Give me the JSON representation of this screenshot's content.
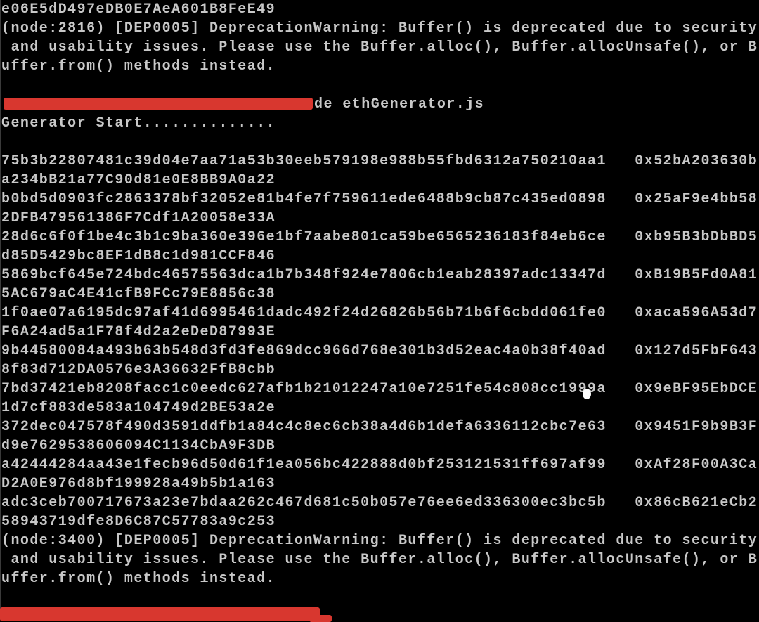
{
  "terminal": {
    "top_line": "e06E5dD497eDB0E7AeA601B8FeE49",
    "warning1": [
      "(node:2816) [DEP0005] DeprecationWarning: Buffer() is deprecated due to security",
      " and usability issues. Please use the Buffer.alloc(), Buffer.allocUnsafe(), or B",
      "uffer.from() methods instead."
    ],
    "command_visible": "de ethGenerator.js",
    "generator_start": "Generator Start..............",
    "rows": [
      {
        "key": "75b3b22807481c39d04e7aa71a53b30eeb579198e988b55fbd6312a750210aa1",
        "addr_head": "0x52bA203630b",
        "addr_tail": "a234bB21a77C90d81e0E8BB9A0a22"
      },
      {
        "key": "b0bd5d0903fc2863378bf32052e81b4fe7f759611ede6488b9cb87c435ed0898",
        "addr_head": "0x25aF9e4bb58",
        "addr_tail": "2DFB479561386F7Cdf1A20058e33A"
      },
      {
        "key": "28d6c6f0f1be4c3b1c9ba360e396e1bf7aabe801ca59be6565236183f84eb6ce",
        "addr_head": "0xb95B3bDbBD5",
        "addr_tail": "d85D5429bc8EF1dB8c1d981CCF846"
      },
      {
        "key": "5869bcf645e724bdc46575563dca1b7b348f924e7806cb1eab28397adc13347d",
        "addr_head": "0xB19B5Fd0A81",
        "addr_tail": "5AC679aC4E41cfB9FCc79E8856c38"
      },
      {
        "key": "1f0ae07a6195dc97af41d6995461dadc492f24d26826b56b71b6f6cbdd061fe0",
        "addr_head": "0xaca596A53d7",
        "addr_tail": "F6A24ad5a1F78f4d2a2eDeD87993E"
      },
      {
        "key": "9b44580084a493b63b548d3fd3fe869dcc966d768e301b3d52eac4a0b38f40ad",
        "addr_head": "0x127d5FbF643",
        "addr_tail": "8f83d712DA0576e3A36632FfB8cbb"
      },
      {
        "key": "7bd37421eb8208facc1c0eedc627afb1b21012247a10e7251fe54c808cc1999a",
        "addr_head": "0x9eBF95EbDCE",
        "addr_tail": "1d7cf883de583a104749d2BE53a2e"
      },
      {
        "key": "372dec047578f490d3591ddfb1a84c4c8ec6cb38a4d6b1defa6336112cbc7e63",
        "addr_head": "0x9451F9b9B3F",
        "addr_tail": "d9e7629538606094C1134CbA9F3DB"
      },
      {
        "key": "a42444284aa43e1fecb96d50d61f1ea056bc422888d0bf253121531ff697af99",
        "addr_head": "0xAf28F00A3Ca",
        "addr_tail": "D2A0E976d8bf199928a49b5b1a163"
      },
      {
        "key": "adc3ceb700717673a23e7bdaa262c467d681c50b057e76ee6ed336300ec3bc5b",
        "addr_head": "0x86cB621eCb2",
        "addr_tail": "58943719dfe8D6C87C57783a9c253"
      }
    ],
    "warning2": [
      "(node:3400) [DEP0005] DeprecationWarning: Buffer() is deprecated due to security",
      " and usability issues. Please use the Buffer.alloc(), Buffer.allocUnsafe(), or B",
      "uffer.from() methods instead."
    ],
    "colors": {
      "background": "#000000",
      "text": "#c8c8c8",
      "redaction": "#d8372f"
    }
  }
}
